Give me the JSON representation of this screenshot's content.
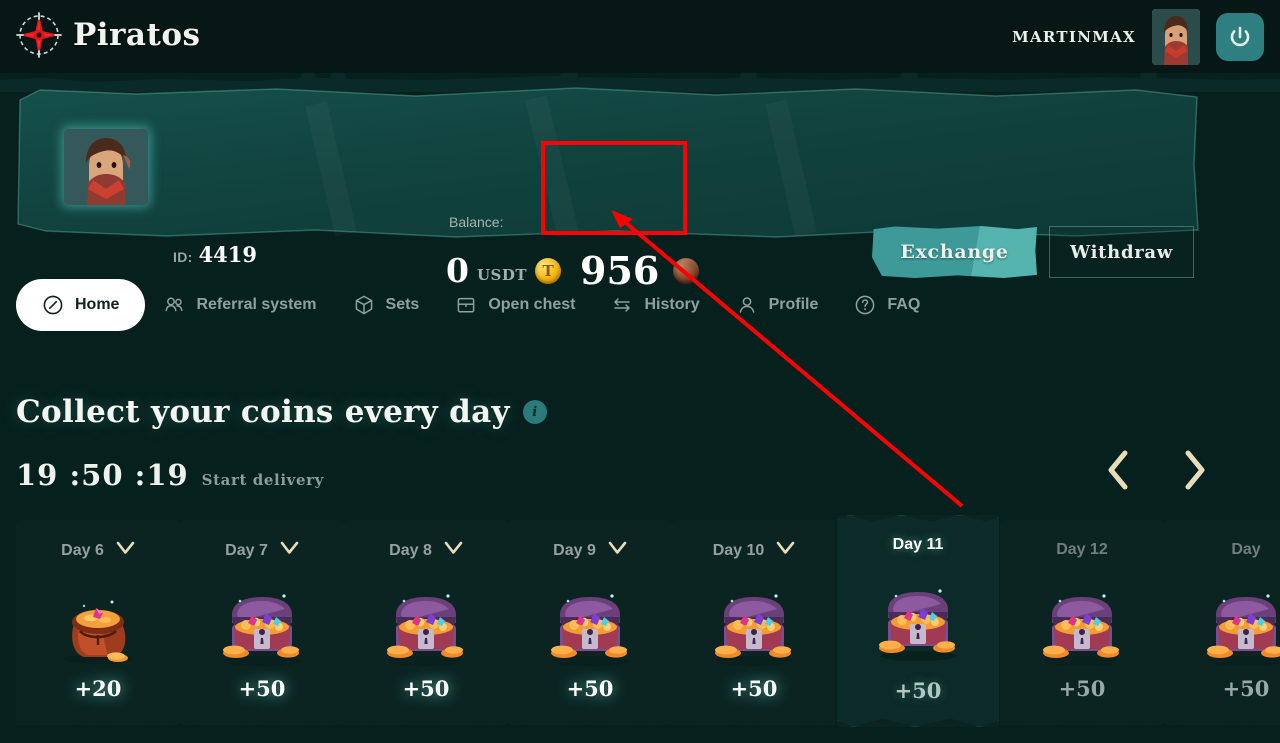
{
  "header": {
    "brand": "Piratos",
    "logo_icon": "compass-rose-icon",
    "username": "MARTINMAX",
    "avatar_icon": "user-avatar",
    "power_icon": "power-icon"
  },
  "banner": {
    "avatar_icon": "profile-avatar-large",
    "id_label": "ID:",
    "id_value": "4419",
    "balance_label": "Balance:",
    "usdt_amount": "0",
    "usdt_ticker": "USDT",
    "usdt_coin_icon": "tether-coin-icon",
    "usdt_coin_glyph": "T",
    "gold_amount": "956",
    "gold_coin_icon": "doubloon-coin-icon",
    "exchange_label": "Exchange",
    "withdraw_label": "Withdraw"
  },
  "nav": {
    "items": [
      {
        "label": "Home",
        "icon": "compass-icon",
        "active": true
      },
      {
        "label": "Referral system",
        "icon": "users-icon",
        "active": false
      },
      {
        "label": "Sets",
        "icon": "cube-icon",
        "active": false
      },
      {
        "label": "Open chest",
        "icon": "chest-icon",
        "active": false
      },
      {
        "label": "History",
        "icon": "swap-arrows-icon",
        "active": false
      },
      {
        "label": "Profile",
        "icon": "person-icon",
        "active": false
      },
      {
        "label": "FAQ",
        "icon": "question-mark-icon",
        "active": false
      }
    ]
  },
  "main": {
    "title": "Collect your coins every day",
    "info_icon": "info-icon",
    "info_glyph": "i",
    "timer": "19 :50 :19",
    "timer_label": "Start delivery",
    "prev_icon": "chevron-left-icon",
    "next_icon": "chevron-right-icon",
    "check_icon": "checkmark-icon",
    "days": [
      {
        "label": "Day 6",
        "amount": "+20",
        "art": "coin-sack-icon",
        "state": "collected"
      },
      {
        "label": "Day 7",
        "amount": "+50",
        "art": "treasure-chest-icon",
        "state": "collected"
      },
      {
        "label": "Day 8",
        "amount": "+50",
        "art": "treasure-chest-icon",
        "state": "collected"
      },
      {
        "label": "Day 9",
        "amount": "+50",
        "art": "treasure-chest-icon",
        "state": "collected"
      },
      {
        "label": "Day 10",
        "amount": "+50",
        "art": "treasure-chest-icon",
        "state": "collected"
      },
      {
        "label": "Day 11",
        "amount": "+50",
        "art": "treasure-chest-icon",
        "state": "active"
      },
      {
        "label": "Day 12",
        "amount": "+50",
        "art": "treasure-chest-icon",
        "state": "locked"
      },
      {
        "label": "Day",
        "amount": "+50",
        "art": "treasure-chest-icon",
        "state": "locked"
      }
    ]
  },
  "annotation": {
    "highlight_box": "red-rectangle-around-gold-balance",
    "arrow": "red-arrow-pointing-to-gold-balance",
    "color": "#ff0000"
  },
  "colors": {
    "page_bg": "#06201d",
    "header_bg": "#071715",
    "banner_teal": "#134743",
    "accent_teal": "#3d9a99",
    "active_glow": "#5ad4cb",
    "card_bg": "#0b2422",
    "cream": "#e8dcb9",
    "annotation_red": "#ff0000"
  }
}
